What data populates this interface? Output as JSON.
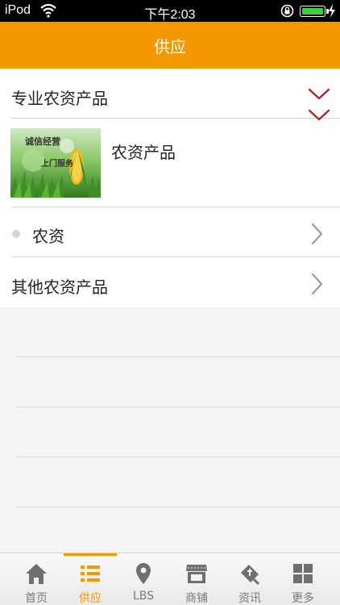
{
  "status_bar": {
    "carrier": "iPod",
    "time": "下午2:03"
  },
  "nav": {
    "title": "供应"
  },
  "list": {
    "items": [
      {
        "label": "专业农资产品",
        "indicator": "chevron-down-icon"
      },
      {
        "label": "农资产品",
        "indicator": "chevron-down-icon",
        "thumbnail_text": [
          "诚信经营",
          "上门服务"
        ]
      },
      {
        "label": "农资",
        "indicator": "chevron-right-icon"
      },
      {
        "label": "其他农资产品",
        "indicator": "chevron-right-icon"
      }
    ]
  },
  "tabs": [
    {
      "label": "首页",
      "icon": "home-icon",
      "active": false
    },
    {
      "label": "供应",
      "icon": "list-icon",
      "active": true
    },
    {
      "label": "LBS",
      "icon": "location-pin-icon",
      "active": false
    },
    {
      "label": "商铺",
      "icon": "shop-icon",
      "active": false
    },
    {
      "label": "资讯",
      "icon": "news-icon",
      "active": false
    },
    {
      "label": "更多",
      "icon": "grid-icon",
      "active": false
    }
  ],
  "colors": {
    "accent": "#f39800",
    "chevron_down": "#a52a2a",
    "chevron_right": "#9a9a9a",
    "tab_inactive": "#7a7a7a"
  }
}
